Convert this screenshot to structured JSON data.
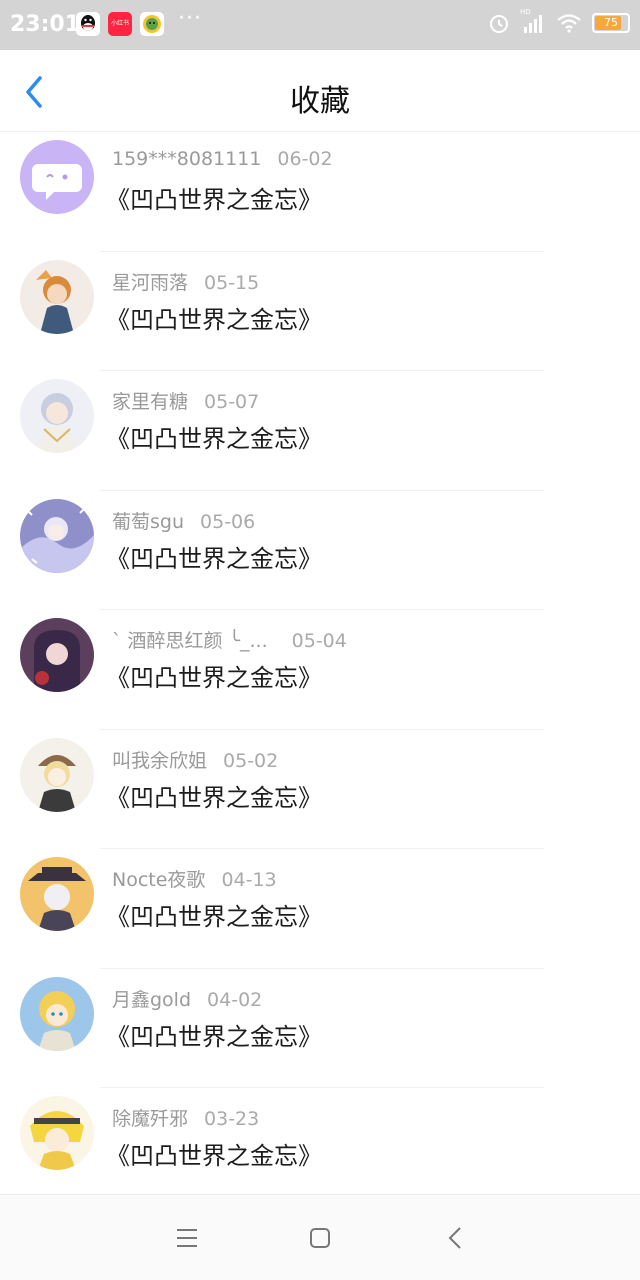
{
  "status_bar": {
    "time": "23:01",
    "apps": [
      "qq-icon",
      "xiaohongshu-icon",
      "app-icon"
    ],
    "xhs_text": "小红书",
    "more": "···",
    "battery": "75",
    "network": "HD"
  },
  "header": {
    "back_icon": "chevron-left-icon",
    "title": "收藏"
  },
  "items": [
    {
      "user": "159***8081111",
      "date": "06-02",
      "title": "《凹凸世界之金忘》"
    },
    {
      "user": "星河雨落",
      "date": "05-15",
      "title": "《凹凸世界之金忘》"
    },
    {
      "user": "家里有糖",
      "date": "05-07",
      "title": "《凹凸世界之金忘》"
    },
    {
      "user": "葡萄sgu",
      "date": "05-06",
      "title": "《凹凸世界之金忘》"
    },
    {
      "user": "ˋ 酒醉思红颜 ╰_...",
      "date": "05-04",
      "title": "《凹凸世界之金忘》"
    },
    {
      "user": "叫我余欣姐",
      "date": "05-02",
      "title": "《凹凸世界之金忘》"
    },
    {
      "user": "Nocte夜歌",
      "date": "04-13",
      "title": "《凹凸世界之金忘》"
    },
    {
      "user": "月鑫gold",
      "date": "04-02",
      "title": "《凹凸世界之金忘》"
    },
    {
      "user": "除魔歼邪",
      "date": "03-23",
      "title": "《凹凸世界之金忘》"
    }
  ],
  "bottom_nav": [
    "menu-icon",
    "home-square-icon",
    "back-triangle-icon"
  ],
  "colors": {
    "accent": "#2a8bf2",
    "status_bar": "#d4d4d4",
    "meta_text": "#9a9a9a",
    "first_avatar_bg": "#c9b4f5"
  }
}
